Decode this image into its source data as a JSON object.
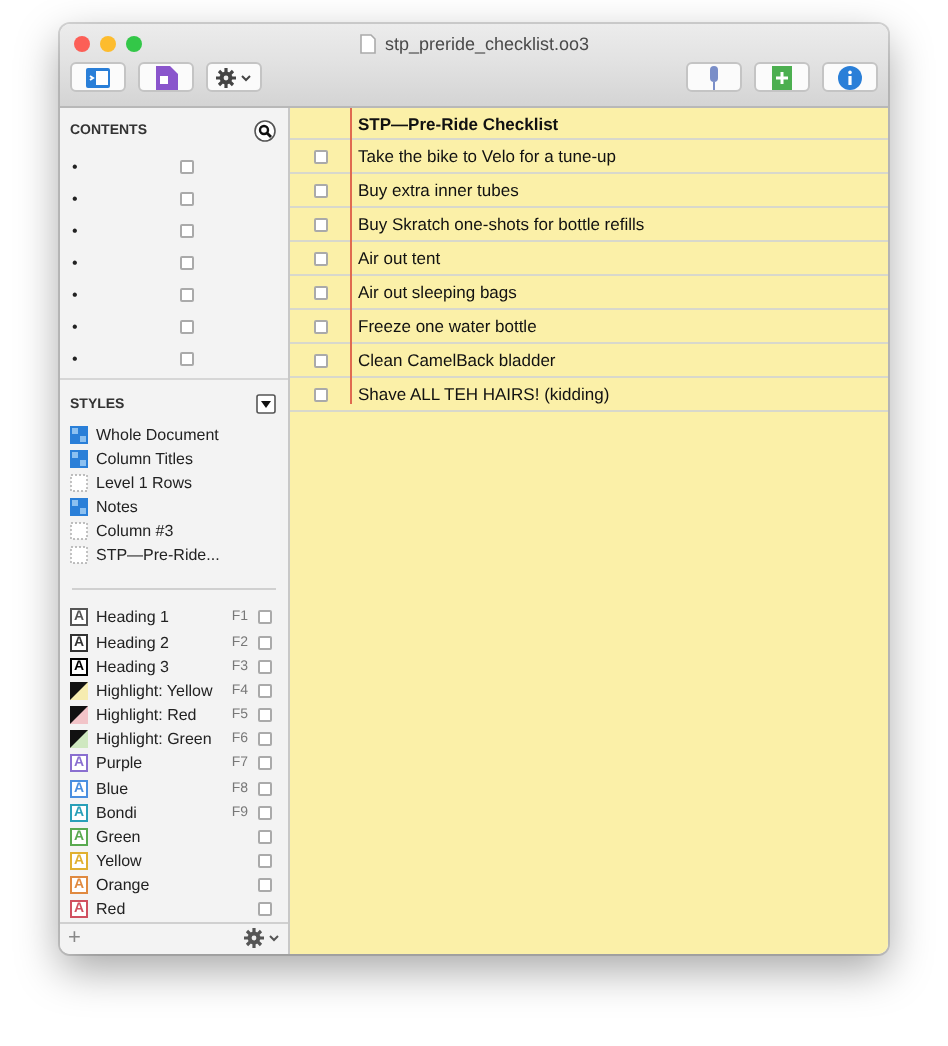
{
  "window": {
    "title": "stp_preride_checklist.oo3"
  },
  "sidebar": {
    "contents_title": "CONTENTS",
    "contents_rows": [
      {
        "bullet": "•",
        "checked": false
      },
      {
        "bullet": "•",
        "checked": false
      },
      {
        "bullet": "•",
        "checked": false
      },
      {
        "bullet": "•",
        "checked": false
      },
      {
        "bullet": "•",
        "checked": false
      },
      {
        "bullet": "•",
        "checked": false
      },
      {
        "bullet": "•",
        "checked": false
      }
    ],
    "styles_title": "STYLES",
    "style_items": [
      {
        "label": "Whole Document",
        "kind": "solid"
      },
      {
        "label": "Column Titles",
        "kind": "solid"
      },
      {
        "label": "Level 1 Rows",
        "kind": "empty"
      },
      {
        "label": "Notes",
        "kind": "solid"
      },
      {
        "label": "Column #3",
        "kind": "empty"
      },
      {
        "label": "STP—Pre-Ride...",
        "kind": "empty"
      }
    ],
    "named_styles": [
      {
        "label": "Heading 1",
        "kind": "letter",
        "swatch": "A",
        "color": "#555555",
        "shortcut": "F1",
        "checked": false
      },
      {
        "label": "Heading 2",
        "kind": "letter",
        "swatch": "A",
        "color": "#333333",
        "shortcut": "F2",
        "checked": false
      },
      {
        "label": "Heading 3",
        "kind": "letter",
        "swatch": "A",
        "color": "#000000",
        "shortcut": "F3",
        "checked": false
      },
      {
        "label": "Highlight: Yellow",
        "kind": "highlight",
        "color": "#f6ecb0",
        "shortcut": "F4",
        "checked": false
      },
      {
        "label": "Highlight: Red",
        "kind": "highlight",
        "color": "#f2c4c8",
        "shortcut": "F5",
        "checked": false
      },
      {
        "label": "Highlight: Green",
        "kind": "highlight",
        "color": "#cfe8c0",
        "shortcut": "F6",
        "checked": false
      },
      {
        "label": "Purple",
        "kind": "letter",
        "swatch": "A",
        "color": "#8a6fd0",
        "shortcut": "F7",
        "checked": false
      },
      {
        "label": "Blue",
        "kind": "letter",
        "swatch": "A",
        "color": "#4a8fe0",
        "shortcut": "F8",
        "checked": false
      },
      {
        "label": "Bondi",
        "kind": "letter",
        "swatch": "A",
        "color": "#2aa0b8",
        "shortcut": "F9",
        "checked": false
      },
      {
        "label": "Green",
        "kind": "letter",
        "swatch": "A",
        "color": "#5aaa50",
        "checked": false
      },
      {
        "label": "Yellow",
        "kind": "letter",
        "swatch": "A",
        "color": "#e0b030",
        "checked": false
      },
      {
        "label": "Orange",
        "kind": "letter",
        "swatch": "A",
        "color": "#e08a40",
        "checked": false
      },
      {
        "label": "Red",
        "kind": "letter",
        "swatch": "A",
        "color": "#d05060",
        "checked": false
      }
    ],
    "bottom_bar": {
      "add": "+"
    }
  },
  "outline": {
    "title": "STP—Pre-Ride Checklist",
    "rows": [
      {
        "text": "Take the bike to Velo for a tune-up",
        "checked": false
      },
      {
        "text": "Buy extra inner tubes",
        "checked": false
      },
      {
        "text": "Buy Skratch one-shots for bottle refills",
        "checked": false
      },
      {
        "text": "Air out tent",
        "checked": false
      },
      {
        "text": "Air out sleeping bags",
        "checked": false
      },
      {
        "text": "Freeze one water bottle",
        "checked": false
      },
      {
        "text": "Clean CamelBack bladder",
        "checked": false
      },
      {
        "text": "Shave ALL TEH HAIRS! (kidding)",
        "checked": false
      }
    ]
  }
}
